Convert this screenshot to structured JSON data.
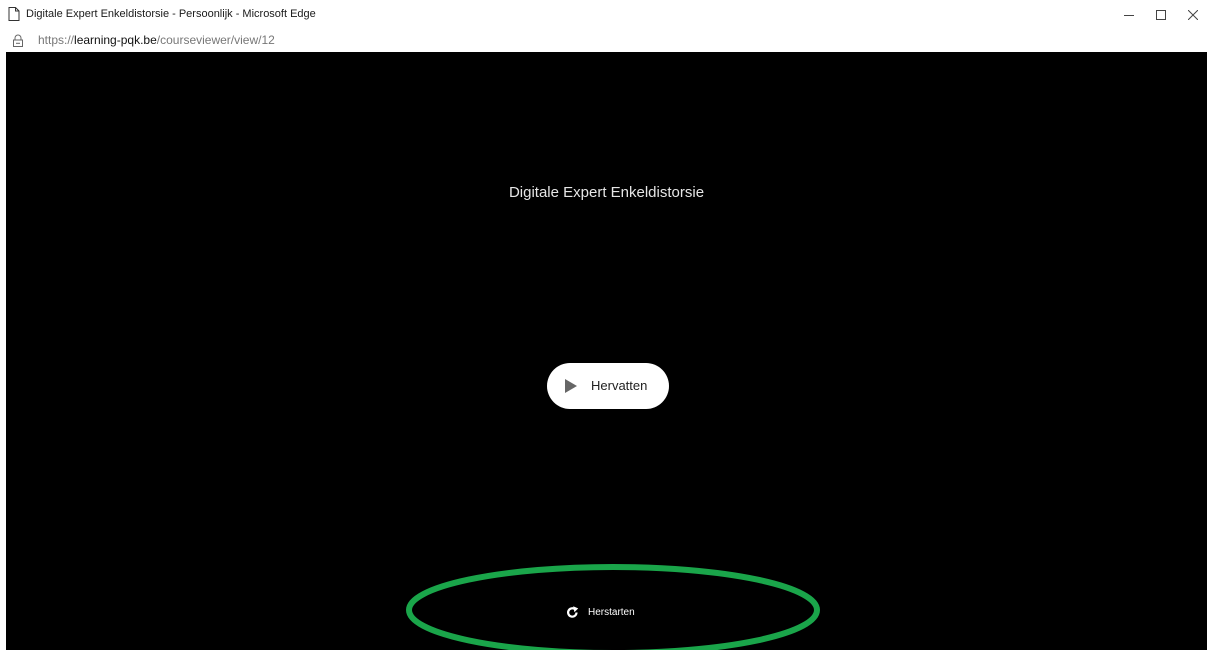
{
  "window": {
    "title": "Digitale Expert Enkeldistorsie - Persoonlijk - Microsoft Edge",
    "controls": [
      "minimize",
      "maximize",
      "close"
    ]
  },
  "address_bar": {
    "protocol": "https://",
    "domain": "learning-pqk.be",
    "path": "/courseviewer/view/12",
    "icon": "lock-icon"
  },
  "player": {
    "course_title": "Digitale Expert Enkeldistorsie",
    "resume_label": "Hervatten",
    "resume_icon": "play-icon",
    "restart_label": "Herstarten",
    "restart_icon": "restart-icon"
  },
  "annotation": {
    "highlight_color": "#1aa54a",
    "target": "restart-button"
  },
  "colors": {
    "player_background": "#000000",
    "title_text": "#e6e6e6",
    "button_background": "#ffffff"
  }
}
